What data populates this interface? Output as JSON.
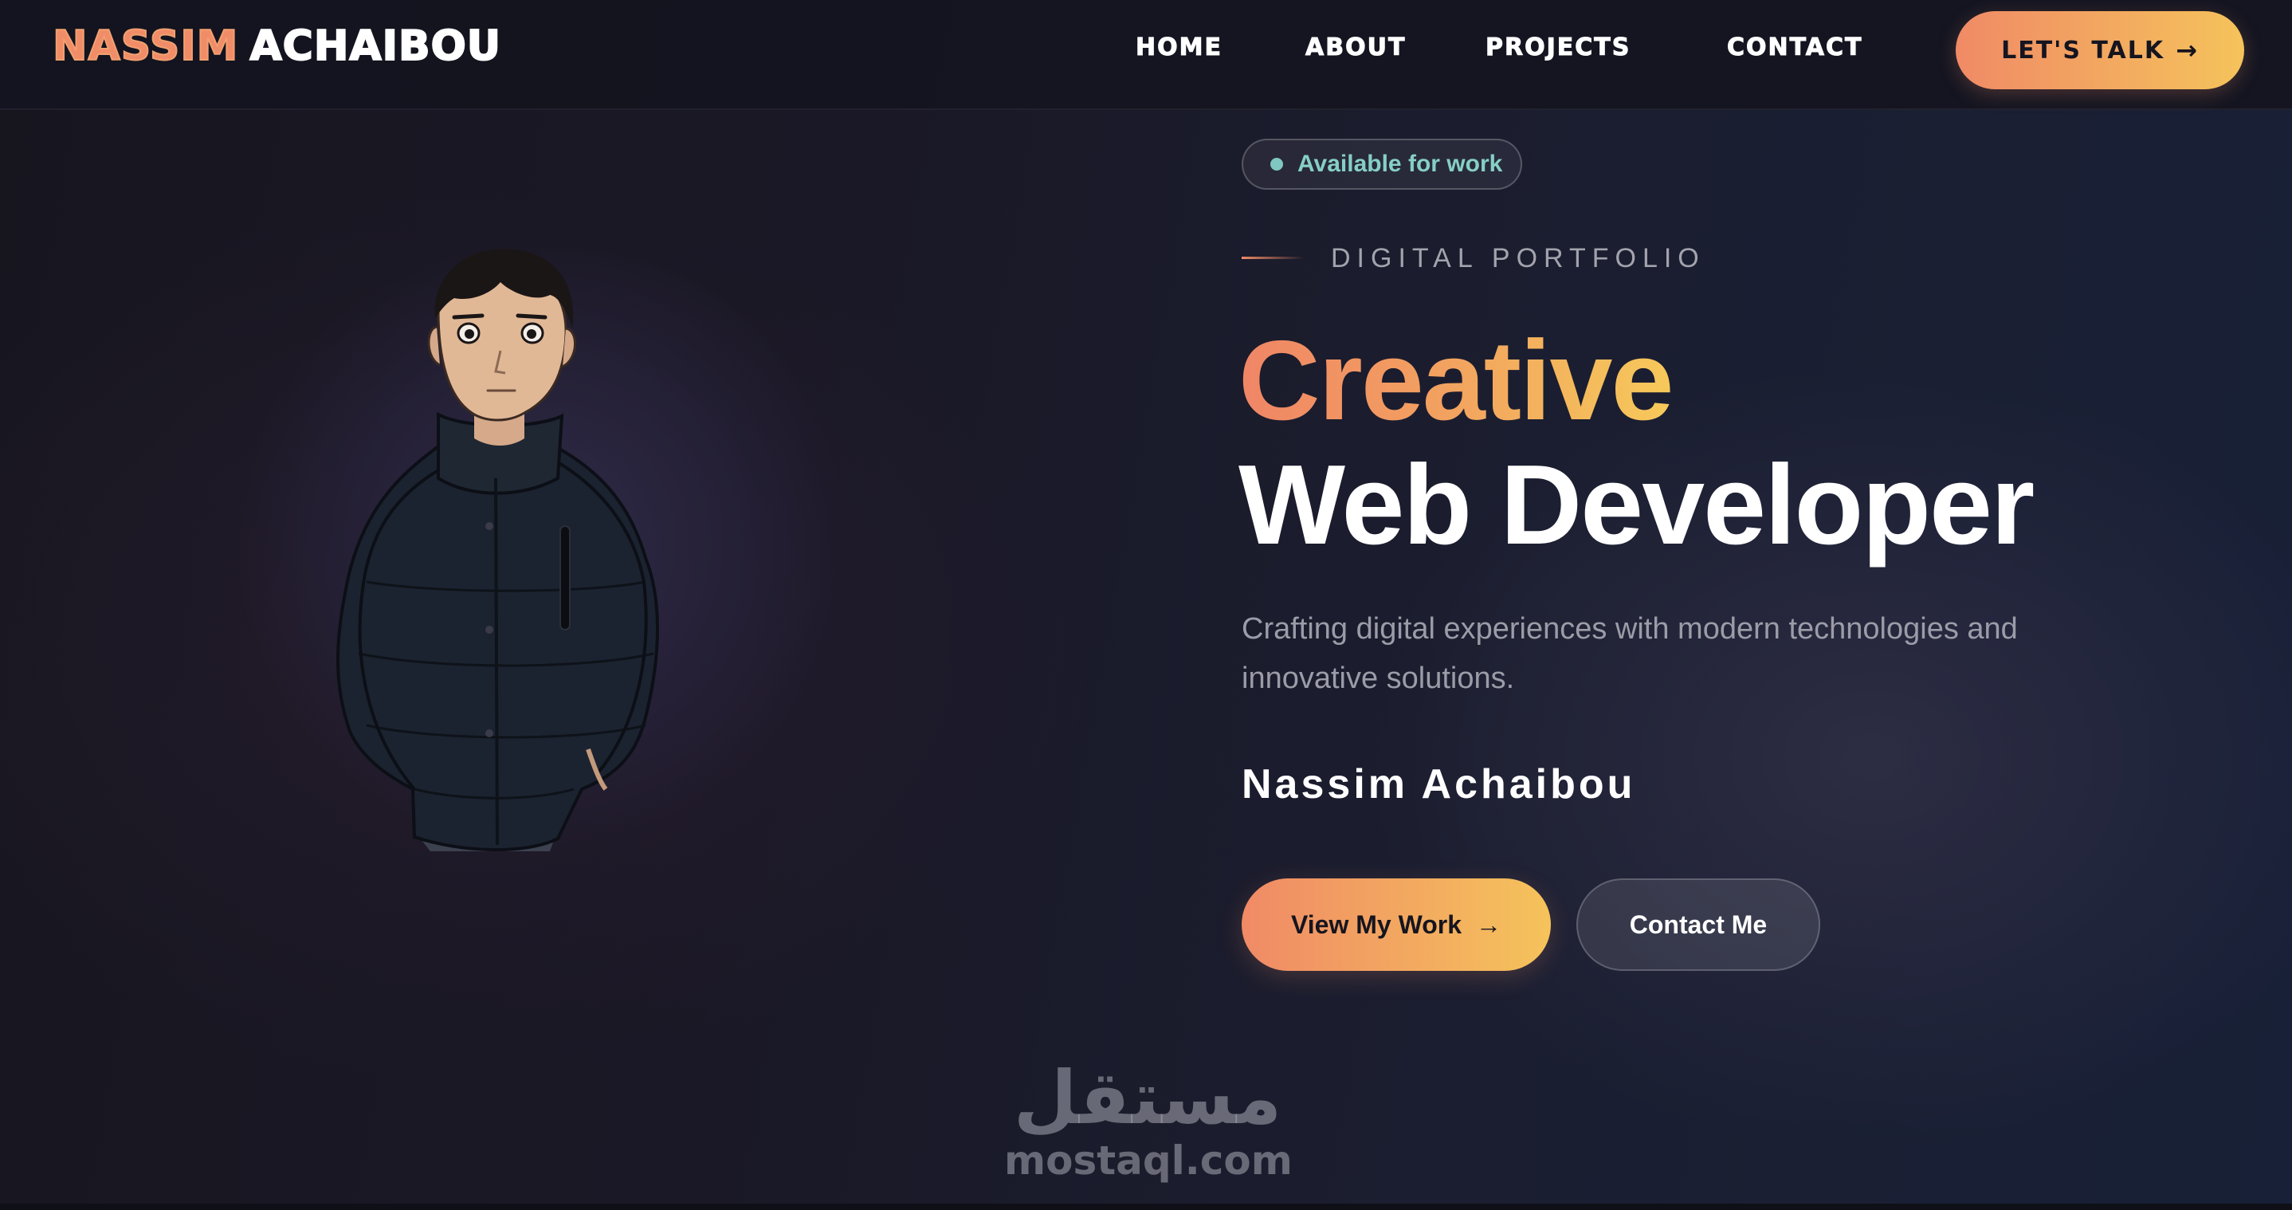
{
  "nav": {
    "logo_first": "Nassim",
    "logo_last": "Achaibou",
    "links": [
      "Home",
      "About",
      "Projects",
      "Contact"
    ],
    "cta_label": "Let's Talk",
    "cta_icon": "arrow-right-icon"
  },
  "hero": {
    "badge": "Available for work",
    "eyebrow": "DIGITAL PORTFOLIO",
    "title_line1": "Creative",
    "title_line2": "Web Developer",
    "description": "Crafting digital experiences with modern technologies and innovative solutions.",
    "name": "Nassim Achaibou",
    "primary_button": "View My Work",
    "secondary_button": "Contact Me"
  },
  "watermark": {
    "arabic": "مستقل",
    "latin": "mostaql.com"
  },
  "colors": {
    "accent_start": "#f08a66",
    "accent_end": "#f5c35b",
    "badge_text": "#86cfc6",
    "background": "#1a1826"
  }
}
